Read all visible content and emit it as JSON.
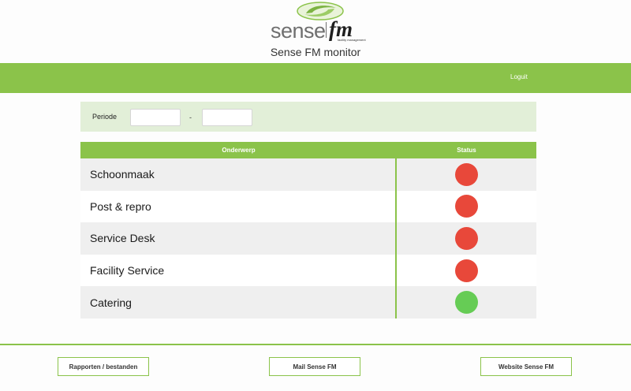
{
  "header": {
    "logo_text_sense": "sense",
    "logo_text_fm": "fm",
    "logo_subtext": "facility management",
    "title": "Sense FM monitor"
  },
  "nav": {
    "logout_label": "Loguit"
  },
  "filter": {
    "period_label": "Periode",
    "separator": "-",
    "from_value": "",
    "to_value": ""
  },
  "table": {
    "headers": {
      "subject": "Onderwerp",
      "status": "Status"
    },
    "rows": [
      {
        "subject": "Schoonmaak",
        "status": "red"
      },
      {
        "subject": "Post & repro",
        "status": "red"
      },
      {
        "subject": "Service Desk",
        "status": "red"
      },
      {
        "subject": "Facility Service",
        "status": "red"
      },
      {
        "subject": "Catering",
        "status": "green"
      }
    ]
  },
  "footer": {
    "reports_label": "Rapporten / bestanden",
    "mail_label": "Mail Sense FM",
    "website_label": "Website Sense FM"
  },
  "colors": {
    "accent": "#8bc34a",
    "status_red": "#e8483a",
    "status_green": "#66cc55"
  },
  "icons": {
    "logo": "sense-fm-swoosh-logo-icon"
  }
}
